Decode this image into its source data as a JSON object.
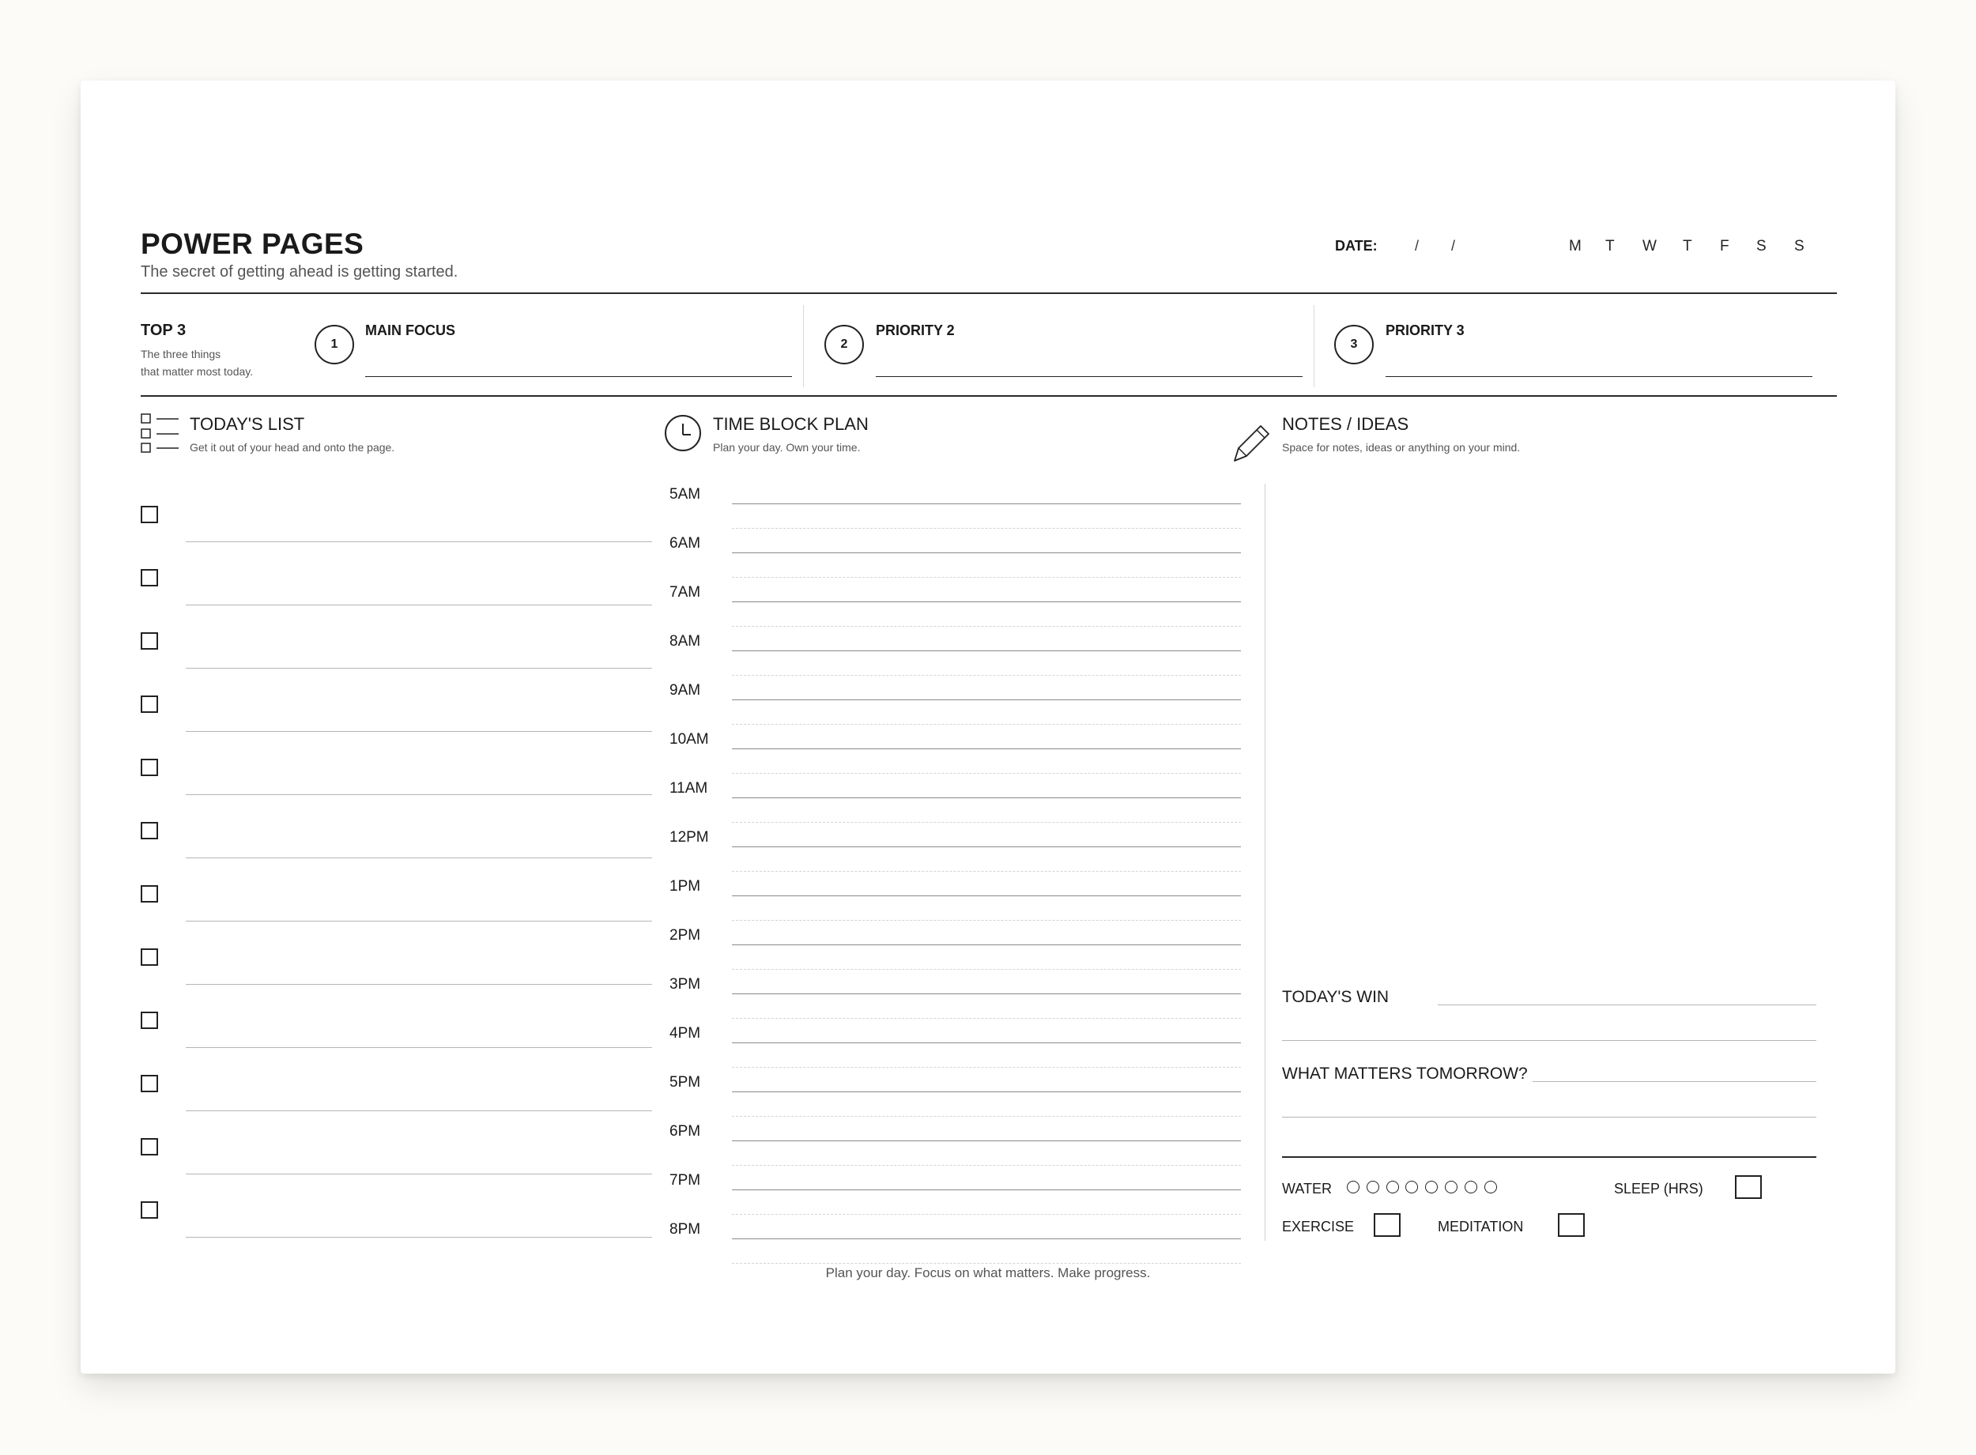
{
  "header": {
    "title": "POWER PAGES",
    "tagline": "The secret of getting ahead is getting started.",
    "date_label": "DATE:",
    "date_separator": "/",
    "weekdays": [
      "M",
      "T",
      "W",
      "T",
      "F",
      "S",
      "S"
    ]
  },
  "top3": {
    "title": "TOP 3",
    "subtitle_line1": "The three things",
    "subtitle_line2": "that matter most today.",
    "priorities": [
      {
        "number": "1",
        "label": "MAIN FOCUS"
      },
      {
        "number": "2",
        "label": "PRIORITY 2"
      },
      {
        "number": "3",
        "label": "PRIORITY 3"
      }
    ]
  },
  "todays_list": {
    "title": "TODAY'S LIST",
    "subtitle": "Get it out of your head and onto the page.",
    "icon": "checklist-icon",
    "item_count": 12
  },
  "time_block": {
    "title": "TIME BLOCK PLAN",
    "subtitle": "Plan your day. Own your time.",
    "icon": "clock-icon",
    "hours": [
      "5AM",
      "6AM",
      "7AM",
      "8AM",
      "9AM",
      "10AM",
      "11AM",
      "12PM",
      "1PM",
      "2PM",
      "3PM",
      "4PM",
      "5PM",
      "6PM",
      "7PM",
      "8PM"
    ]
  },
  "notes": {
    "title": "NOTES / IDEAS",
    "subtitle": "Space for notes, ideas or anything on your mind.",
    "icon": "pencil-icon"
  },
  "reflection": {
    "todays_win": "TODAY'S WIN",
    "what_matters_tomorrow": "WHAT MATTERS TOMORROW?"
  },
  "trackers": {
    "water": "WATER",
    "water_glasses": 8,
    "sleep": "SLEEP (HRS)",
    "exercise": "EXERCISE",
    "meditation": "MEDITATION"
  },
  "footer": "Plan your day. Focus on what matters. Make progress."
}
